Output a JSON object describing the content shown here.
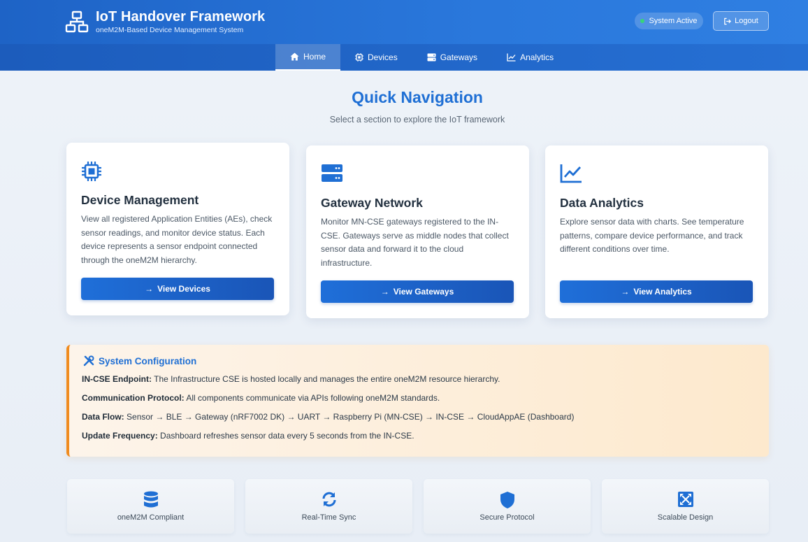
{
  "app": {
    "title": "IoT Handover Framework",
    "subtitle": "oneM2M-Based Device Management System",
    "status": "System Active",
    "logout": "Logout"
  },
  "nav": [
    {
      "label": "Home",
      "icon": "home-icon",
      "active": true
    },
    {
      "label": "Devices",
      "icon": "chip-icon",
      "active": false
    },
    {
      "label": "Gateways",
      "icon": "server-icon",
      "active": false
    },
    {
      "label": "Analytics",
      "icon": "chart-line-icon",
      "active": false
    }
  ],
  "quick_nav": {
    "title": "Quick Navigation",
    "subtitle": "Select a section to explore the IoT framework"
  },
  "cards": [
    {
      "icon": "chip-icon",
      "title": "Device Management",
      "desc": "View all registered Application Entities (AEs), check sensor readings, and monitor device status. Each device represents a sensor endpoint connected through the oneM2M hierarchy.",
      "button": "View Devices"
    },
    {
      "icon": "server-icon",
      "title": "Gateway Network",
      "desc": "Monitor MN-CSE gateways registered to the IN-CSE. Gateways serve as middle nodes that collect sensor data and forward it to the cloud infrastructure.",
      "button": "View Gateways"
    },
    {
      "icon": "chart-line-icon",
      "title": "Data Analytics",
      "desc": "Explore sensor data with charts. See temperature patterns, compare device performance, and track different conditions over time.",
      "button": "View Analytics"
    }
  ],
  "config": {
    "title": "System Configuration",
    "items": [
      {
        "label": "IN-CSE Endpoint:",
        "text": "The Infrastructure CSE is hosted locally and manages the entire oneM2M resource hierarchy."
      },
      {
        "label": "Communication Protocol:",
        "text": "All components communicate via APIs following oneM2M standards."
      },
      {
        "label": "Data Flow:",
        "text": "Sensor → BLE → Gateway (nRF7002 DK) → UART → Raspberry Pi (MN-CSE) → IN-CSE → CloudAppAE (Dashboard)"
      },
      {
        "label": "Update Frequency:",
        "text": "Dashboard refreshes sensor data every 5 seconds from the IN-CSE."
      }
    ]
  },
  "features": [
    {
      "icon": "database-icon",
      "label": "oneM2M Compliant"
    },
    {
      "icon": "sync-icon",
      "label": "Real-Time Sync"
    },
    {
      "icon": "shield-icon",
      "label": "Secure Protocol"
    },
    {
      "icon": "expand-icon",
      "label": "Scalable Design"
    }
  ],
  "colors": {
    "primary": "#1f6fd4",
    "header": "#2a78dc",
    "accent_orange": "#f08b1e",
    "status_green": "#38d47a"
  }
}
